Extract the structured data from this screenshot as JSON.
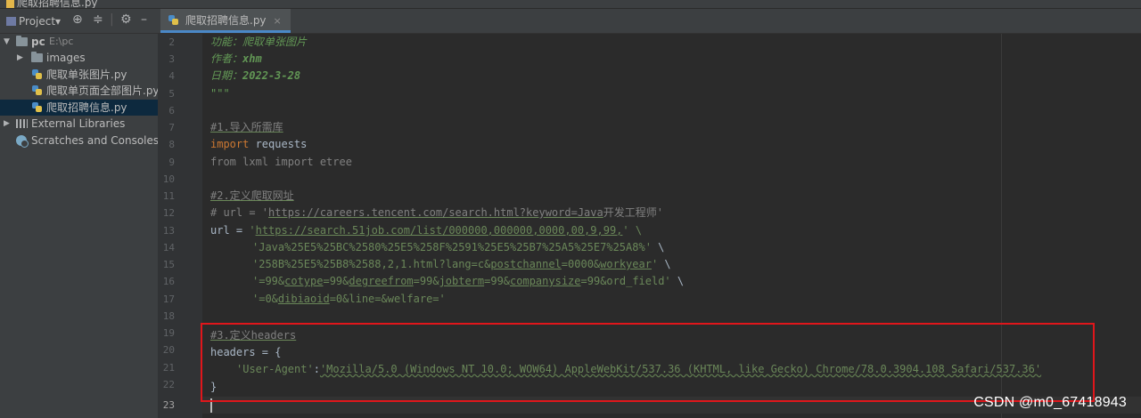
{
  "titlebar": {
    "crumb": "爬取招聘信息.py"
  },
  "project_panel": {
    "selector_label": "Project▾",
    "tree": [
      {
        "label": "pc",
        "hint": "E:\\pc"
      },
      {
        "label": "images"
      },
      {
        "label": "爬取单张图片.py"
      },
      {
        "label": "爬取单页面全部图片.py"
      },
      {
        "label": "爬取招聘信息.py"
      },
      {
        "label": "External Libraries"
      },
      {
        "label": "Scratches and Consoles"
      }
    ]
  },
  "tabs": [
    {
      "label": "爬取招聘信息.py",
      "close": "×"
    }
  ],
  "editor": {
    "line_numbers": [
      "2",
      "3",
      "4",
      "5",
      "6",
      "7",
      "8",
      "9",
      "10",
      "11",
      "12",
      "13",
      "14",
      "15",
      "16",
      "17",
      "18",
      "19",
      "20",
      "21",
      "22",
      "23"
    ],
    "current_line": "23",
    "code": {
      "l2": "功能：爬取单张图片",
      "l3a": "作者：",
      "l3b": "xhm",
      "l4a": "日期：",
      "l4b": "2022-3-28",
      "l5": "\"\"\"",
      "l7": "#1.导入所需库",
      "l8a": "import",
      "l8b": " requests",
      "l9": "from lxml import etree",
      "l11": "#2.定义爬取网址",
      "l12a": "# url = '",
      "l12b": "https://careers.tencent.com/search.html?keyword=Java",
      "l12c": "开发工程师'",
      "l13a": "url = ",
      "l13b": "'",
      "l13c": "https://search.51job.com/list/000000,000000,0000,00,9,99,",
      "l13d": "' \\",
      "l14a": "'Java%25E5%25BC%2580%25E5%258F%2591%25E5%25B7%25A5%25E7%25A8%'",
      "l14b": " \\",
      "l15a": "'258B%25E5%25B8%2588,2,1.html?lang=c&",
      "l15b": "postchannel",
      "l15c": "=0000&",
      "l15d": "workyear",
      "l15e": "'",
      "l15f": " \\",
      "l16a": "'=99&",
      "l16b": "cotype",
      "l16c": "=99&",
      "l16d": "degreefrom",
      "l16e": "=99&",
      "l16f": "jobterm",
      "l16g": "=99&",
      "l16h": "companysize",
      "l16i": "=99&ord_field'",
      "l16j": " \\",
      "l17a": "'=0&",
      "l17b": "dibiaoid",
      "l17c": "=0&line=&welfare='",
      "l19": "#3.定义headers",
      "l20": "headers = {",
      "l21a": "'User-Agent'",
      "l21b": ":",
      "l21c": "'Mozilla/5.0 (Windows NT 10.0; WOW64) AppleWebKit/537.36 (KHTML, like Gecko) Chrome/78.0.3904.108 Safari/537.36'",
      "l22": "}"
    }
  },
  "watermark": "CSDN @m0_67418943"
}
